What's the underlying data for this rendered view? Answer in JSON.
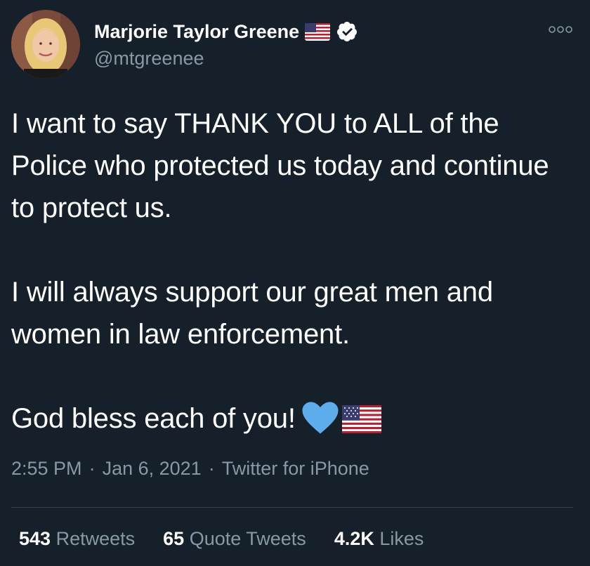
{
  "author": {
    "display_name": "Marjorie Taylor Greene",
    "handle": "@mtgreenee"
  },
  "icons": {
    "name_emoji": "us-flag-icon",
    "verified": "verified-badge-icon",
    "more": "more-options-icon",
    "heart": "blue-heart-emoji-icon",
    "flag": "us-flag-icon"
  },
  "tweet": {
    "paragraphs": [
      "I want to say THANK YOU to ALL of the Police who protected us today and continue to protect us.",
      "I will always support our great men and women in law enforcement.",
      "God bless each of you!"
    ]
  },
  "meta": {
    "time": "2:55 PM",
    "separator": "·",
    "date": "Jan 6, 2021",
    "source": "Twitter for iPhone"
  },
  "stats": {
    "retweets_count": "543",
    "retweets_label": "Retweets",
    "quotes_count": "65",
    "quotes_label": "Quote Tweets",
    "likes_count": "4.2K",
    "likes_label": "Likes"
  },
  "colors": {
    "background": "#15202b",
    "text": "#ffffff",
    "secondary_text": "#8899a6",
    "divider": "#38444d",
    "heart": "#5dadec"
  }
}
